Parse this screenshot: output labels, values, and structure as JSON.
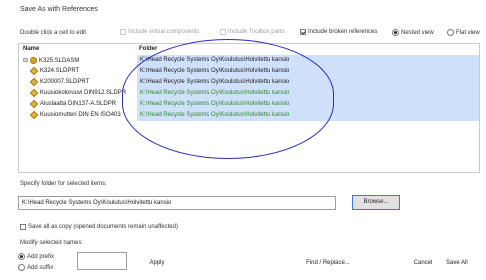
{
  "window": {
    "title": "Save As with References"
  },
  "toolbar": {
    "hint": "Double click a cell to edit",
    "include_virtual": "Include virtual components",
    "include_toolbox": "Include Toolbox parts",
    "include_broken": "Include broken references",
    "nested_view": "Nested view",
    "flat_view": "Flat view"
  },
  "table": {
    "headers": {
      "name": "Name",
      "folder": "Folder"
    },
    "rows": [
      {
        "name": "K325.SLDASM",
        "folder": "K:\\Head Recycle Systems Oy\\Koulutus\\Holvitettu kansio",
        "tree": "⊟",
        "icon": "assembly-icon",
        "folder_color": "#1e1e1e"
      },
      {
        "name": "K324.SLDPRT",
        "folder": "K:\\Head Recycle Systems Oy\\Koulutus\\Holvitettu kansio",
        "tree": "",
        "icon": "part-icon",
        "folder_color": "#1e1e1e"
      },
      {
        "name": "K200007.SLDPRT",
        "folder": "K:\\Head Recycle Systems Oy\\Koulutus\\Holvitettu kansio",
        "tree": "",
        "icon": "part-icon",
        "folder_color": "#1e1e1e"
      },
      {
        "name": "Kuusiokoloruuvi DIN912.SLDPR",
        "folder": "K:\\Head Recycle Systems Oy\\Koulutus\\Holvitettu kansio",
        "tree": "",
        "icon": "part-icon",
        "folder_color": "#2e8b2e"
      },
      {
        "name": "Aluslaatta DIN137-A.SLDPR",
        "folder": "K:\\Head Recycle Systems Oy\\Koulutus\\Holvitettu kansio",
        "tree": "",
        "icon": "part-icon",
        "folder_color": "#2e8b2e"
      },
      {
        "name": "Kuusiomutteri DIN EN ISO403",
        "folder": "K:\\Head Recycle Systems Oy\\Koulutus\\Holvitettu kansio",
        "tree": "",
        "icon": "part-icon",
        "folder_color": "#2e8b2e"
      }
    ]
  },
  "folder_section": {
    "label": "Specify folder for selected items:",
    "value": "K:\\Head Recycle Systems Oy\\Koulutus\\Holvitettu kansio",
    "browse": "Browse..."
  },
  "save_all_copy": "Save all as copy (opened documents remain unaffected)",
  "modify": {
    "label": "Modify selected names:",
    "add_prefix": "Add prefix",
    "add_suffix": "Add suffix",
    "apply": "Apply",
    "find_replace": "Find / Replace..."
  },
  "footer": {
    "cancel": "Cancel",
    "save_all": "Save All"
  },
  "colors": {
    "selection": "#cfe0fa",
    "annotation": "#2a2fb8",
    "green_text": "#2e8b2e"
  }
}
